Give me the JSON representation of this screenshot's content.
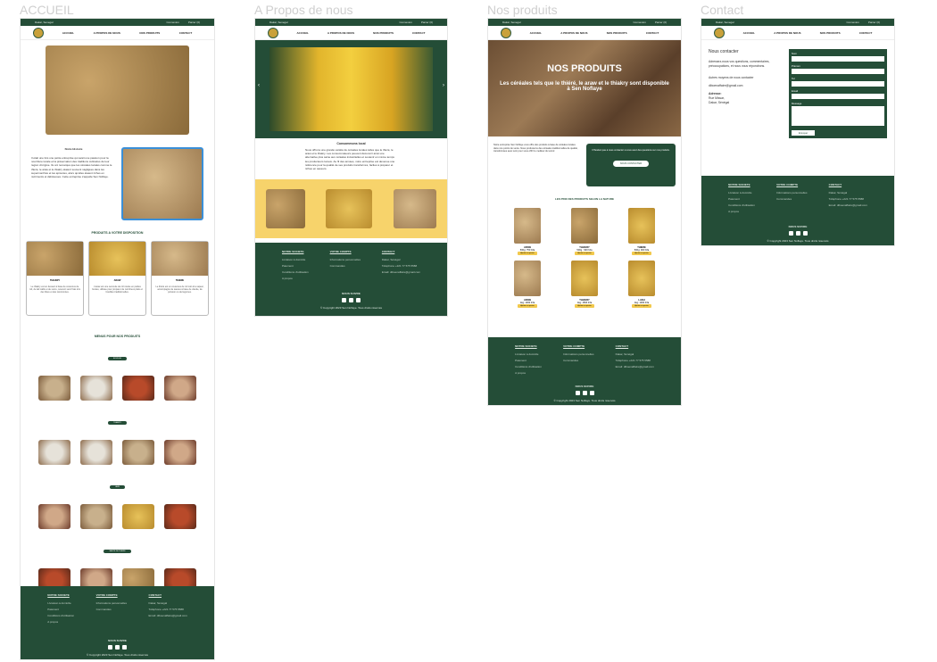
{
  "frames": {
    "accueil": "ACCUEIL",
    "apropos": "A Propos de nous",
    "produits": "Nos produits",
    "contact": "Contact"
  },
  "topbar": {
    "left": "Dakar, Senegal",
    "connexion": "Connexion",
    "panier": "Panier (0)"
  },
  "nav": [
    "ACCUEIL",
    "A PROPOS DE NOUS",
    "NOS PRODUITS",
    "CONTACT"
  ],
  "accueil": {
    "history_title": "Notre Histoire",
    "history_text": "Il était une fois une petite entreprise qui avait une passion pour la nourriture locale et la préservation des traditions culinaires de leur région d'origine. Ils ont remarqué que les céréales locales comme le thiéré, le araw et le thiakry étaient souvent négligées dans les supermarchés et les épiceries, alors qu'elles étaient riches en nutriments et délicieuses. Cette entreprise s'appelle Sen Noflaye.",
    "products_title": "PRODUITS A VOTRE DISPOSITION",
    "products": [
      {
        "name": "THIAKRY",
        "desc": "Le thiakry est un dessert à base de couscous de mil, de lait caillé et de sucre, souvent servi frais lors des fêtes et des cérémonies."
      },
      {
        "name": "ARAW",
        "desc": "L'araw est une semoule de mil roulée en petites boules, utilisée pour préparer de nombreux plats et bouillies traditionnelles."
      },
      {
        "name": "THIERE",
        "desc": "Le thiéré est un couscous de mil cuit à la vapeur, accompagné de sauces à base de viande, de poisson ou de légumes."
      }
    ],
    "menus_title": "MENUS POUR NOS PRODUITS",
    "menu_groups": [
      "BOUILLIE",
      "THIAKRY",
      "LAKH",
      "SAUCE DE THIERE"
    ]
  },
  "apropos": {
    "title": "Consommons local",
    "text": "Nous offrons une grande variété de céréales locales telles que le thiéré, le araw et le thiakry. Les consommateurs peuvent découvrir ainsi une alternative plus saine aux céréales industrielles et soutenir en même temps les producteurs locaux. Au fil des années, notre entreprise est devenue une référence pour la qualité de ses produits transformés, faciles à préparer et riches en saveurs."
  },
  "produits": {
    "hero_title": "NOS PRODUITS",
    "hero_sub": "Les céréales tels que le thiéré, le araw et le thiakry sont disponible à Sen Noflaye",
    "intro": "Notre entreprise Sen Noflaye vous offre des produits à base de céréales locales dans nos points de vente. Nous produisons des céréales traditionnelles de qualité, transformées avec soin pour vous offrir le meilleur du terroir.",
    "cta_text": "N'hésitez pas à nous contacter si vous avez des questions sur nos produits.",
    "cta_button": "NOUS CONTACTER",
    "list_title": "LES PRIX DES PRODUITS SELON LA NATURE",
    "items": [
      {
        "name": "ARAW",
        "price": "500g: 750 fcfa"
      },
      {
        "name": "THIAKRY",
        "price": "500g : 900 fcfa"
      },
      {
        "name": "THIERE",
        "price": "500g: 900 fcfa"
      },
      {
        "name": "ARAW",
        "price": "1kg: 1300 fcfa"
      },
      {
        "name": "THIAKRY",
        "price": "1kg: 1500 fcfa"
      },
      {
        "name": "LAKH",
        "price": "1kg: 1300 fcfa"
      }
    ],
    "badge": "Ajouter au panier"
  },
  "contact": {
    "title": "Nous contacter",
    "text": "Adressez-nous vos questions, commentaires, préoccupations, et nous vous répondrons.",
    "other": "Autres moyens de nous contacter",
    "email": "diboenaffaire@gmail.com",
    "address_label": "Adresse:",
    "address1": "Rue Missar,",
    "address2": "Dakar, Sénégal",
    "fields": [
      "Nom",
      "Prénom",
      "Tel",
      "Email",
      "Message"
    ],
    "send": "Envoyer"
  },
  "footer": {
    "col1_title": "NOTRE SOCIETE",
    "col1": [
      "Livraison à domicile",
      "Paiement",
      "Conditions d'utilisation",
      "A propos"
    ],
    "col2_title": "VOTRE COMPTE",
    "col2": [
      "Informations personnelles",
      "Commandes"
    ],
    "col3_title": "CONTACT",
    "col3": [
      "Dakar, Sénégal",
      "Téléphone +221 77 575 5588",
      "Email: diboenaffaire@gmail.com"
    ],
    "follow": "NOUS SUIVRE",
    "copyright": "© Copyright 2023 Sen Noflaye. Tous droits réservés"
  }
}
